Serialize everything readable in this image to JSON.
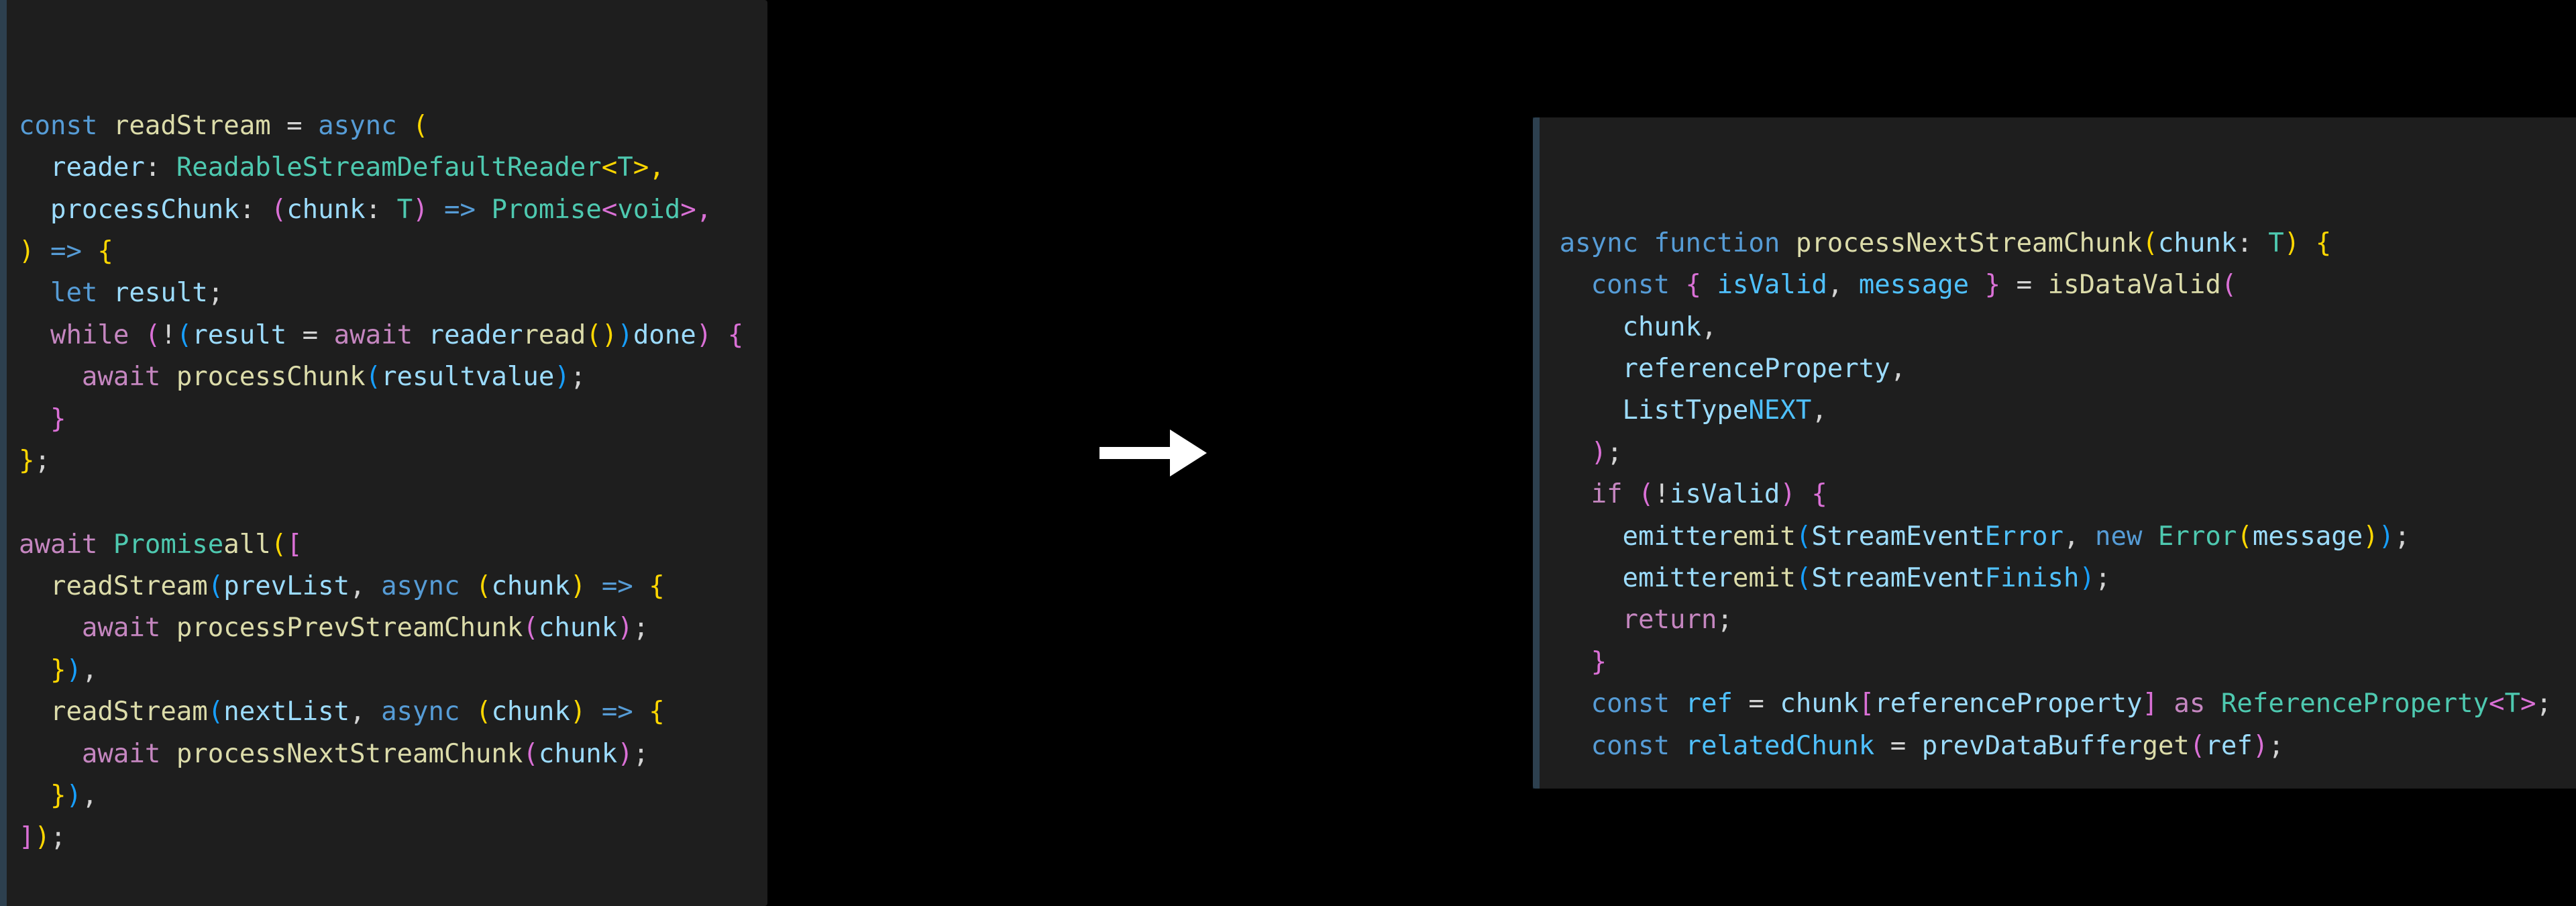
{
  "left": {
    "l1": {
      "const": "const",
      "name": "readStream",
      "eq": " = ",
      "async": "async",
      "open": " ("
    },
    "l2": {
      "param": "reader",
      "colon": ": ",
      "type": "ReadableStreamDefaultReader",
      "lt": "<",
      "tp": "T",
      "gt": ">,"
    },
    "l3": {
      "param": "processChunk",
      "colon": ": ",
      "open": "(",
      "p2": "chunk",
      "colon2": ": ",
      "tp": "T",
      "close": ")",
      "arrow": " => ",
      "ret": "Promise",
      "lt": "<",
      "void": "void",
      "gt": ">,"
    },
    "l4": {
      "close": ")",
      "arrow": " => ",
      "brace": "{"
    },
    "l5": {
      "let": "let",
      "name": " result",
      "semi": ";"
    },
    "l6": {
      "while": "while",
      "sp": " ",
      "o1": "(",
      "bang": "!",
      "o2": "(",
      "res": "result",
      "eq": " = ",
      "await": "await",
      "sp2": " ",
      "reader": "reader",
      ".": ".",
      "read": "read",
      "o3": "(",
      ")3": ")",
      ")2": ")",
      ".2": ".",
      "done": "done",
      ")1": ")",
      "sp3": " ",
      "brace": "{"
    },
    "l7": {
      "await": "await",
      "sp": " ",
      "fn": "processChunk",
      "o": "(",
      "arg": "result",
      ".": ".",
      "val": "value",
      ")": ")",
      ";": ";"
    },
    "l8": {
      "brace": "}"
    },
    "l9": {
      "brace": "}",
      ";": ";"
    },
    "l11": {
      "await": "await",
      "sp": " ",
      "prom": "Promise",
      ".": ".",
      "all": "all",
      "o": "(",
      "br": "["
    },
    "l12": {
      "fn": "readStream",
      "o": "(",
      "a1": "prevList",
      ",": ", ",
      "async": "async",
      "sp": " ",
      "o2": "(",
      "p": "chunk",
      ")2": ")",
      "arrow": " => ",
      "brace": "{"
    },
    "l13": {
      "await": "await",
      "sp": " ",
      "fn": "processPrevStreamChunk",
      "o": "(",
      "a": "chunk",
      ")": ")",
      ";": ";"
    },
    "l14": {
      "brace": "}",
      ")": ")",
      ",": ","
    },
    "l15": {
      "fn": "readStream",
      "o": "(",
      "a1": "nextList",
      ",": ", ",
      "async": "async",
      "sp": " ",
      "o2": "(",
      "p": "chunk",
      ")2": ")",
      "arrow": " => ",
      "brace": "{"
    },
    "l16": {
      "await": "await",
      "sp": " ",
      "fn": "processNextStreamChunk",
      "o": "(",
      "a": "chunk",
      ")": ")",
      ";": ";"
    },
    "l17": {
      "brace": "}",
      ")": ")",
      ",": ","
    },
    "l18": {
      "br": "]",
      ")": ")",
      ";": ";"
    }
  },
  "right": {
    "l1": {
      "async": "async",
      "sp": " ",
      "function": "function",
      "sp2": " ",
      "name": "processNextStreamChunk",
      "o": "(",
      "p": "chunk",
      ":": ": ",
      "tp": "T",
      ")": ")",
      "sp3": " ",
      "brace": "{"
    },
    "l2": {
      "const": "const",
      "sp": " ",
      "ob": "{",
      "sp2": " ",
      "v1": "isValid",
      ",": ", ",
      "v2": "message",
      "sp3": " ",
      "cb": "}",
      "eq": " = ",
      "fn": "isDataValid",
      "o": "("
    },
    "l3": {
      "a": "chunk",
      ",": ","
    },
    "l4": {
      "a": "referenceProperty",
      ",": ","
    },
    "l5": {
      "t": "ListType",
      ".": ".",
      "m": "NEXT",
      ",": ","
    },
    "l6": {
      ")": ")",
      ";": ";"
    },
    "l7": {
      "if": "if",
      "sp": " ",
      "o": "(",
      "bang": "!",
      "v": "isValid",
      ")": ")",
      "sp2": " ",
      "brace": "{"
    },
    "l8": {
      "obj": "emitter",
      ".": ".",
      "fn": "emit",
      "o": "(",
      "t": "StreamEvent",
      ".2": ".",
      "m": "Error",
      ",": ", ",
      "new": "new",
      "sp": " ",
      "err": "Error",
      "o2": "(",
      "a": "message",
      ")2": ")",
      ")": ")",
      ";": ";"
    },
    "l9": {
      "obj": "emitter",
      ".": ".",
      "fn": "emit",
      "o": "(",
      "t": "StreamEvent",
      ".2": ".",
      "m": "Finish",
      ")": ")",
      ";": ";"
    },
    "l10": {
      "return": "return",
      ";": ";"
    },
    "l11": {
      "brace": "}"
    },
    "l12": {
      "const": "const",
      "sp": " ",
      "name": "ref",
      "eq": " = ",
      "obj": "chunk",
      "ob": "[",
      "idx": "referenceProperty",
      "cb": "]",
      "sp2": " ",
      "as": "as",
      "sp3": " ",
      "type": "ReferenceProperty",
      "lt": "<",
      "tp": "T",
      "gt": ">",
      ";": ";"
    },
    "l13": {
      "const": "const",
      "sp": " ",
      "name": "relatedChunk",
      "eq": " = ",
      "obj": "prevDataBuffer",
      ".": ".",
      "fn": "get",
      "o": "(",
      "a": "ref",
      ")": ")",
      ";": ";"
    }
  },
  "arrow_label": "arrow-right"
}
